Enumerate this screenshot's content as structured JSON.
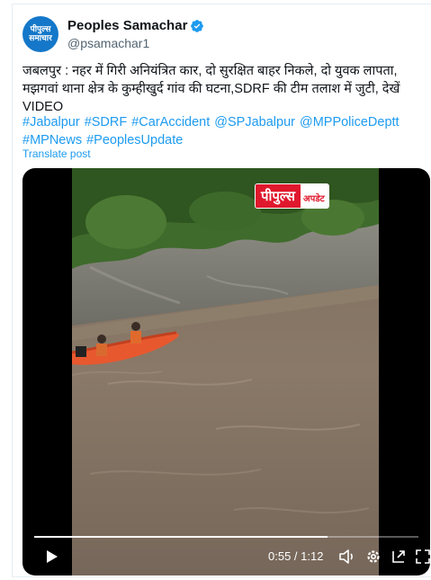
{
  "tweet": {
    "display_name": "Peoples Samachar",
    "handle": "@psamachar1",
    "avatar_text": [
      "पीपुल्स",
      "समाचार"
    ],
    "text": "जबलपुर : नहर में गिरी अनियंत्रित कार, दो सुरक्षित बाहर निकले, दो युवक लापता, मझगवां थाना क्षेत्र के कुम्हीखुर्द गांव की घटना,SDRF की टीम तलाश में जुटी, देखें VIDEO",
    "hashtags": [
      "#Jabalpur",
      "#SDRF",
      "#CarAccident",
      "@SPJabalpur",
      "@MPPoliceDeptt",
      "#MPNews",
      "#PeoplesUpdate"
    ],
    "translate_label": "Translate post"
  },
  "video": {
    "overlay_logo_main": "पीपुल्स",
    "overlay_logo_sub": "अपडेट",
    "time_display": "0:55 / 1:12",
    "progress_fraction": 0.764
  },
  "colors": {
    "link": "#1d9bf0",
    "text": "#0f1419",
    "muted": "#536471",
    "verified": "#1d9bf0",
    "brand_red": "#e0182d"
  },
  "icons": [
    "verified-badge-icon",
    "play-icon",
    "volume-icon",
    "settings-gear-icon",
    "popout-icon",
    "fullscreen-icon"
  ]
}
